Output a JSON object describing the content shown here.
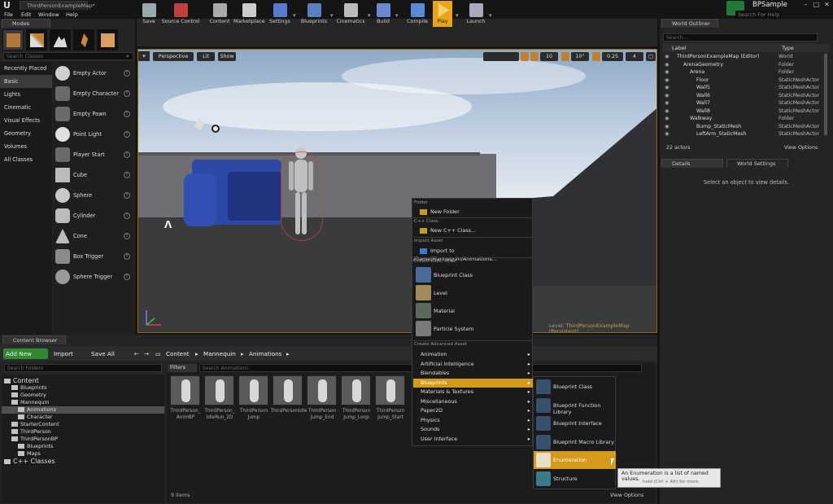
{
  "window": {
    "doc_tab": "ThirdPersonExampleMap*",
    "project": "BPSample",
    "help_placeholder": "Search For Help",
    "min": "–",
    "max": "□",
    "close": "✕"
  },
  "menu": [
    "File",
    "Edit",
    "Window",
    "Help"
  ],
  "modes": {
    "tab": "Modes",
    "search_placeholder": "Search Classes",
    "categories": [
      "Recently Placed",
      "Basic",
      "Lights",
      "Cinematic",
      "Visual Effects",
      "Geometry",
      "Volumes",
      "All Classes"
    ],
    "selected_category": "Basic",
    "items": [
      "Empty Actor",
      "Empty Character",
      "Empty Pawn",
      "Point Light",
      "Player Start",
      "Cube",
      "Sphere",
      "Cylinder",
      "Cone",
      "Box Trigger",
      "Sphere Trigger"
    ]
  },
  "toolbar": [
    "Save",
    "Source Control",
    "Content",
    "Marketplace",
    "Settings",
    "Blueprints",
    "Cinematics",
    "Build",
    "Compile",
    "Play",
    "Launch"
  ],
  "viewport": {
    "perspective": "Perspective",
    "lit": "Lit",
    "show": "Show",
    "grid": "10",
    "angle": "10°",
    "scale": "0.25",
    "cams": "4",
    "level_prefix": "Level:",
    "level_name": "ThirdPersonExampleMap (Persistent)"
  },
  "outliner": {
    "tab": "World Outliner",
    "search_placeholder": "Search...",
    "col_label": "Label",
    "col_type": "Type",
    "rows": [
      {
        "name": "ThirdPersonExampleMap (Editor)",
        "type": "World"
      },
      {
        "name": "ArenaGeometry",
        "type": "Folder"
      },
      {
        "name": "Arena",
        "type": "Folder"
      },
      {
        "name": "Floor",
        "type": "StaticMeshActor"
      },
      {
        "name": "Wall5",
        "type": "StaticMeshActor"
      },
      {
        "name": "Wall6",
        "type": "StaticMeshActor"
      },
      {
        "name": "Wall7",
        "type": "StaticMeshActor"
      },
      {
        "name": "Wall8",
        "type": "StaticMeshActor"
      },
      {
        "name": "Walkway",
        "type": "Folder"
      },
      {
        "name": "Bump_StaticMesh",
        "type": "StaticMeshActor"
      },
      {
        "name": "LeftArm_StaticMesh",
        "type": "StaticMeshActor"
      }
    ],
    "count": "22 actors",
    "view_options": "View Options"
  },
  "details": {
    "tab": "Details",
    "tab2": "World Settings",
    "empty_msg": "Select an object to view details."
  },
  "content_browser": {
    "tab": "Content Browser",
    "add_new": "Add New",
    "import": "Import",
    "save_all": "Save All",
    "crumbs": [
      "Content",
      "Mannequin",
      "Animations"
    ],
    "folder_search": "Search Folders",
    "filters": "Filters",
    "asset_search": "Search Animations",
    "tree": [
      {
        "label": "Content",
        "indent": 0
      },
      {
        "label": "Blueprints",
        "indent": 1
      },
      {
        "label": "Geometry",
        "indent": 1
      },
      {
        "label": "Mannequin",
        "indent": 1
      },
      {
        "label": "Animations",
        "indent": 2
      },
      {
        "label": "Character",
        "indent": 2
      },
      {
        "label": "StarterContent",
        "indent": 1
      },
      {
        "label": "ThirdPerson",
        "indent": 1
      },
      {
        "label": "ThirdPersonBP",
        "indent": 1
      },
      {
        "label": "Blueprints",
        "indent": 2
      },
      {
        "label": "Maps",
        "indent": 2
      },
      {
        "label": "C++ Classes",
        "indent": 0
      }
    ],
    "assets": [
      {
        "l1": "ThirdPerson_",
        "l2": "AnimBP"
      },
      {
        "l1": "ThirdPerson_",
        "l2": "IdleRun_2D"
      },
      {
        "l1": "ThirdPerson",
        "l2": "Jump"
      },
      {
        "l1": "ThirdPersonIdle",
        "l2": ""
      },
      {
        "l1": "ThirdPerson",
        "l2": "Jump_End"
      },
      {
        "l1": "ThirdPerson",
        "l2": "Jump_Loop"
      },
      {
        "l1": "ThirdPerson",
        "l2": "Jump_Start"
      }
    ],
    "items_count": "9 items",
    "view_options": "View Options"
  },
  "context_menu": {
    "sec_folder": "Folder",
    "new_folder": "New Folder",
    "sec_cpp": "C++ Class",
    "new_cpp": "New C++ Class...",
    "sec_import": "Import Asset",
    "import_to": "Import to /Game/Mannequin/Animations...",
    "sec_basic": "Create Basic Asset",
    "basic": [
      "Blueprint Class",
      "Level",
      "Material",
      "Particle System"
    ],
    "sec_adv": "Create Advanced Asset",
    "adv": [
      "Animation",
      "Artificial Intelligence",
      "Blendables",
      "Blueprints",
      "Materials & Textures",
      "Miscellaneous",
      "Paper2D",
      "Physics",
      "Sounds",
      "User Interface"
    ],
    "selected": "Blueprints"
  },
  "submenu": {
    "items": [
      "Blueprint Class",
      "Blueprint Function Library",
      "Blueprint Interface",
      "Blueprint Macro Library",
      "Enumeration",
      "Structure"
    ],
    "selected": "Enumeration"
  },
  "tooltip": {
    "line1": "An Enumeration is a list of named values.",
    "line2": "hold (Ctrl + Alt) for more"
  }
}
